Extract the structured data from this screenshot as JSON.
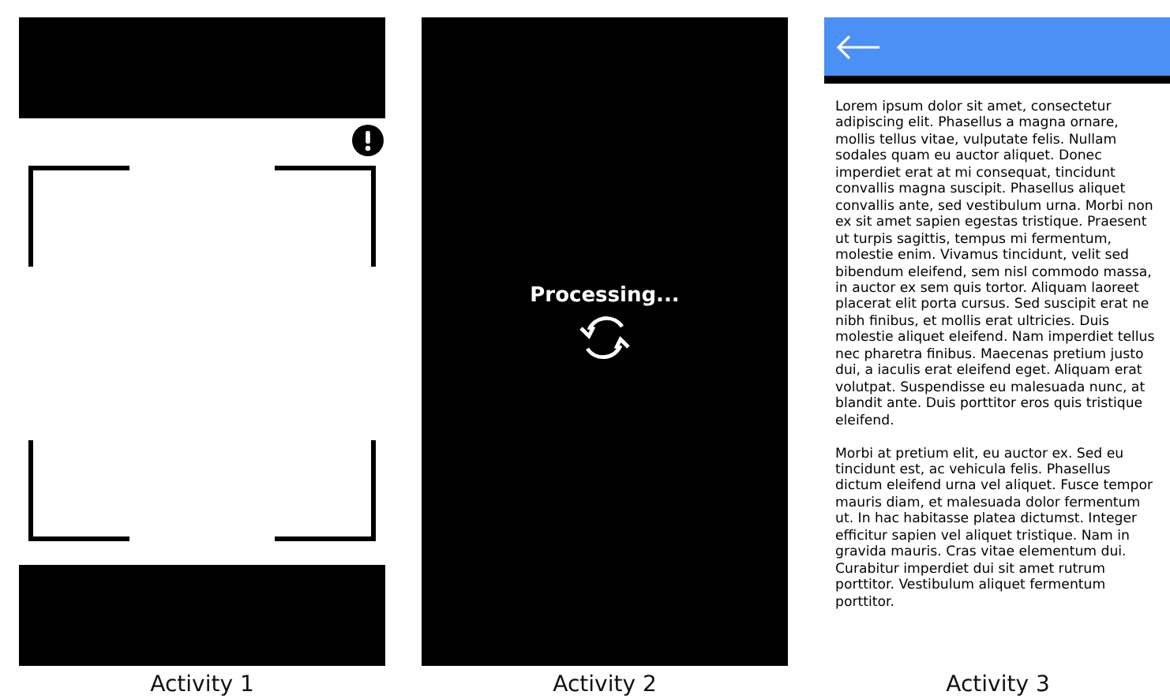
{
  "activities": [
    {
      "kind": "scanner",
      "caption": "Activity 1"
    },
    {
      "kind": "processing",
      "status": "Processing...",
      "caption": "Activity 2"
    },
    {
      "kind": "reader",
      "caption": "Activity 3",
      "paragraphs": [
        [
          "Lorem ipsum dolor sit amet, consectetur",
          "adipiscing elit. Phasellus a magna ornare,",
          "mollis tellus vitae, vulputate felis. Nullam",
          "sodales quam eu auctor aliquet. Donec",
          "imperdiet erat at mi consequat, tincidunt",
          "convallis magna suscipit. Phasellus aliquet",
          "convallis ante, sed vestibulum urna. Morbi non",
          "ex sit amet sapien egestas tristique. Praesent",
          "ut turpis sagittis, tempus mi fermentum,",
          "molestie enim. Vivamus tincidunt, velit sed",
          "bibendum eleifend, sem nisl commodo massa,",
          "in auctor ex sem quis tortor. Aliquam laoreet",
          "placerat elit porta cursus. Sed suscipit erat ne",
          "nibh finibus, et mollis erat ultricies. Duis",
          "molestie aliquet eleifend. Nam imperdiet tellus",
          "nec pharetra finibus. Maecenas pretium justo",
          "dui, a iaculis erat eleifend eget. Aliquam erat",
          "volutpat. Suspendisse eu malesuada nunc, at",
          "blandit ante. Duis porttitor eros quis tristique",
          "eleifend."
        ],
        [
          "Morbi at pretium elit, eu auctor ex. Sed eu",
          "tincidunt est, ac vehicula felis. Phasellus",
          "dictum eleifend urna vel aliquet. Fusce tempor",
          "mauris diam, et malesuada dolor fermentum",
          "ut. In hac habitasse platea dictumst. Integer",
          "efficitur sapien vel aliquet tristique. Nam in",
          "gravida mauris. Cras vitae elementum dui.",
          "Curabitur imperdiet dui sit amet rutrum",
          "porttitor. Vestibulum aliquet fermentum",
          "porttitor."
        ]
      ]
    }
  ]
}
